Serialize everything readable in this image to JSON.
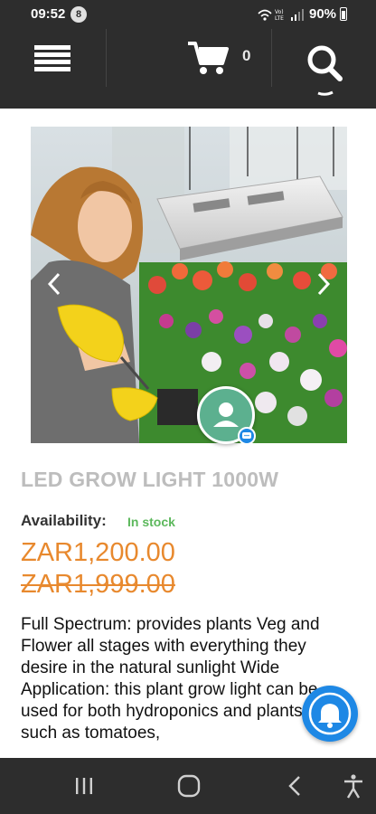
{
  "status_bar": {
    "time": "09:52",
    "notification_count": "8",
    "battery": "90%"
  },
  "header": {
    "menu_icon": "hamburger-menu-icon",
    "cart_icon": "shopping-cart-icon",
    "cart_count": "0",
    "search_icon": "search-icon"
  },
  "product": {
    "title": "LED GROW LIGHT 1000W",
    "availability_label": "Availability:",
    "stock_status": "In stock",
    "price": "ZAR1,200.00",
    "old_price": "ZAR1,999.00",
    "description": "Full Spectrum: provides plants Veg and Flower all stages with everything they desire in the natural sunlight Wide Application: this plant grow light can be used for both hydroponics and plants in soil, such as tomatoes,"
  },
  "colors": {
    "header_bg": "#2d2d2d",
    "price": "#e8892e",
    "stock": "#5cb85c",
    "title": "#bdbdbd",
    "accent": "#1e88e5",
    "chat": "#5cb08f"
  },
  "nav": {
    "recents_icon": "recent-apps-icon",
    "home_icon": "home-icon",
    "back_icon": "back-icon",
    "accessibility_icon": "accessibility-icon"
  }
}
